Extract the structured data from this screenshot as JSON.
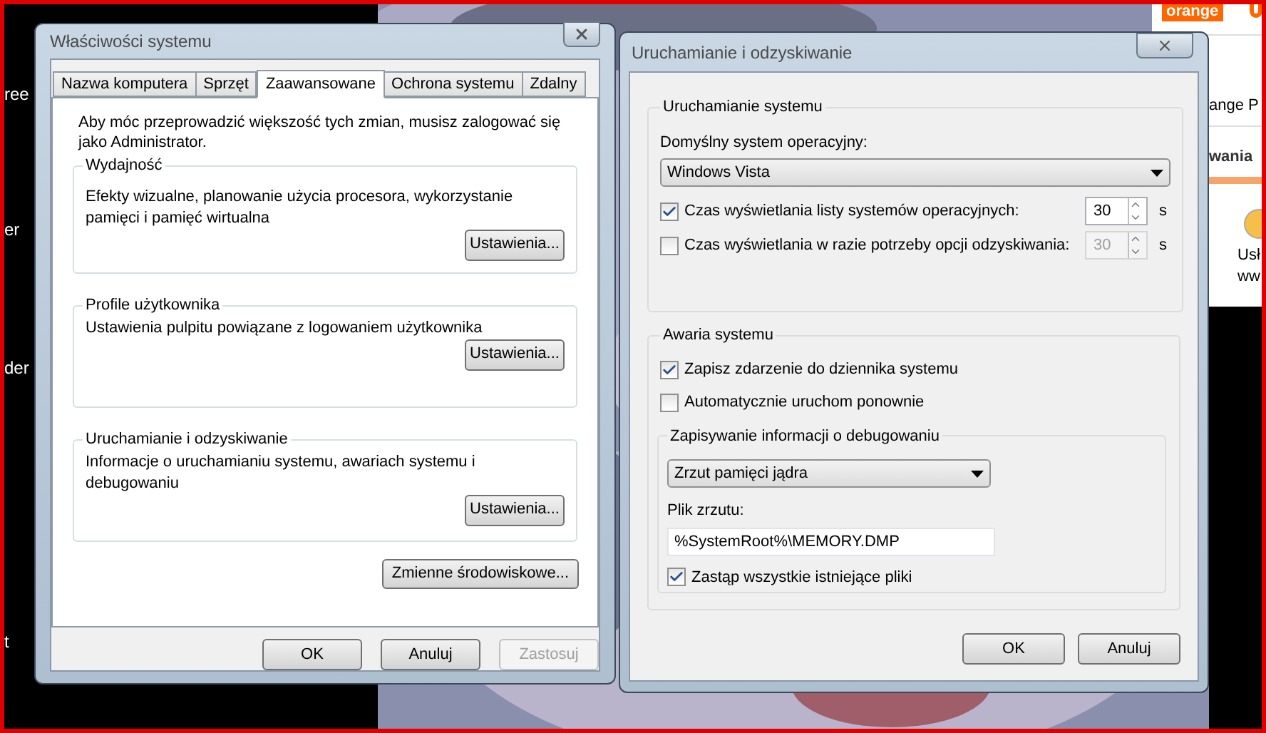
{
  "desktop": {
    "icon_labels": [
      "ree",
      "er",
      "der",
      "t"
    ]
  },
  "browser_fragment": {
    "logo": "orange",
    "header_text": "ange P",
    "tab_text": "wania",
    "service_label": [
      "Usł",
      "ww"
    ]
  },
  "system_properties": {
    "title": "Właściwości systemu",
    "tabs": [
      {
        "label": "Nazwa komputera",
        "selected": false
      },
      {
        "label": "Sprzęt",
        "selected": false
      },
      {
        "label": "Zaawansowane",
        "selected": true
      },
      {
        "label": "Ochrona systemu",
        "selected": false
      },
      {
        "label": "Zdalny",
        "selected": false
      }
    ],
    "notice": "Aby móc przeprowadzić większość tych zmian, musisz zalogować się jako Administrator.",
    "groups": [
      {
        "title": "Wydajność",
        "description": "Efekty wizualne, planowanie użycia procesora, wykorzystanie pamięci i pamięć wirtualna",
        "button": "Ustawienia..."
      },
      {
        "title": "Profile użytkownika",
        "description": "Ustawienia pulpitu powiązane z logowaniem użytkownika",
        "button": "Ustawienia..."
      },
      {
        "title": "Uruchamianie i odzyskiwanie",
        "description": "Informacje o uruchamianiu systemu, awariach systemu i debugowaniu",
        "button": "Ustawienia..."
      }
    ],
    "env_button": "Zmienne środowiskowe...",
    "buttons": [
      {
        "label": "OK",
        "disabled": false
      },
      {
        "label": "Anuluj",
        "disabled": false
      },
      {
        "label": "Zastosuj",
        "disabled": true
      }
    ]
  },
  "startup_recovery": {
    "title": "Uruchamianie i odzyskiwanie",
    "startup": {
      "title": "Uruchamianie systemu",
      "default_os_label": "Domyślny system operacyjny:",
      "default_os_value": "Windows Vista",
      "timeouts": [
        {
          "label": "Czas wyświetlania listy systemów operacyjnych:",
          "checked": true,
          "value": "30",
          "unit": "s"
        },
        {
          "label": "Czas wyświetlania w razie potrzeby opcji odzyskiwania:",
          "checked": false,
          "value": "30",
          "unit": "s"
        }
      ]
    },
    "failure": {
      "title": "Awaria systemu",
      "options": [
        {
          "label": "Zapisz zdarzenie do dziennika systemu",
          "checked": true
        },
        {
          "label": "Automatycznie uruchom ponownie",
          "checked": false
        }
      ],
      "debug": {
        "title": "Zapisywanie informacji o debugowaniu",
        "dump_type": "Zrzut pamięci jądra",
        "dump_file_label": "Plik zrzutu:",
        "dump_file_value": "%SystemRoot%\\MEMORY.DMP",
        "overwrite": {
          "label": "Zastąp wszystkie istniejące pliki",
          "checked": true
        }
      }
    },
    "buttons": [
      {
        "label": "OK",
        "disabled": false
      },
      {
        "label": "Anuluj",
        "disabled": false
      }
    ]
  }
}
